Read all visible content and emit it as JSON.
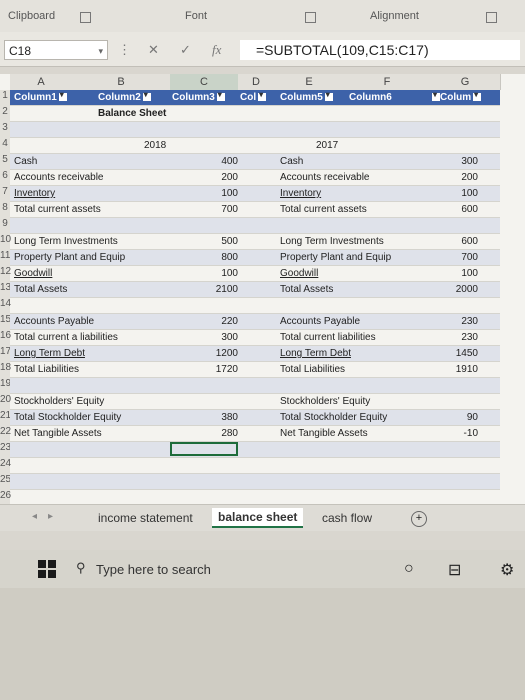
{
  "ribbon": {
    "clipboard": "Clipboard",
    "font": "Font",
    "alignment": "Alignment"
  },
  "formula": {
    "cell_ref": "C18",
    "cancel_icon": "close-icon",
    "enter_icon": "check-icon",
    "fx": "fx",
    "value": "=SUBTOTAL(109,C15:C17)"
  },
  "columns": [
    "A",
    "B",
    "C",
    "D",
    "E",
    "F",
    "G"
  ],
  "header_row": {
    "col1": "Column1",
    "col2": "Column2",
    "col3": "Column3",
    "col4": "Col",
    "col5": "Column5",
    "col6": "Column6",
    "col7": "Colum"
  },
  "rows": {
    "r2_title": "Balance Sheet",
    "r4_2018": "2018",
    "r4_2017": "2017",
    "r5": {
      "label": "Cash",
      "v2018": "400",
      "label2": "Cash",
      "v2017": "300"
    },
    "r6": {
      "label": "Accounts receivable",
      "v2018": "200",
      "label2": "Accounts receivable",
      "v2017": "200"
    },
    "r7": {
      "label": "Inventory",
      "v2018": "100",
      "label2": "Inventory",
      "v2017": "100"
    },
    "r8": {
      "label": "Total current assets",
      "v2018": "700",
      "label2": "Total current assets",
      "v2017": "600"
    },
    "r10": {
      "label": "Long Term Investments",
      "v2018": "500",
      "label2": "Long Term Investments",
      "v2017": "600"
    },
    "r11": {
      "label": "Property Plant and Equip",
      "v2018": "800",
      "label2": "Property Plant and Equip",
      "v2017": "700"
    },
    "r12": {
      "label": "Goodwill",
      "v2018": "100",
      "label2": "Goodwill",
      "v2017": "100"
    },
    "r13": {
      "label": "Total Assets",
      "v2018": "2100",
      "label2": "Total Assets",
      "v2017": "2000"
    },
    "r15": {
      "label": "Accounts Payable",
      "v2018": "220",
      "label2": "Accounts Payable",
      "v2017": "230"
    },
    "r16": {
      "label": "Total current a liabilities",
      "v2018": "300",
      "label2": "Total current liabilities",
      "v2017": "230"
    },
    "r17": {
      "label": "Long Term Debt",
      "v2018": "1200",
      "label2": "Long Term Debt",
      "v2017": "1450"
    },
    "r18": {
      "label": "Total Liabilities",
      "v2018": "1720",
      "label2": "Total Liabilities",
      "v2017": "1910"
    },
    "r20": {
      "label": "Stockholders' Equity",
      "label2": "Stockholders' Equity"
    },
    "r21": {
      "label": "Total Stockholder Equity",
      "v2018": "380",
      "label2": "Total Stockholder Equity",
      "v2017": "90"
    },
    "r22": {
      "label": "Net Tangible Assets",
      "v2018": "280",
      "label2": "Net Tangible Assets",
      "v2017": "-10"
    }
  },
  "row_numbers": [
    "1",
    "2",
    "3",
    "4",
    "5",
    "6",
    "7",
    "8",
    "9",
    "10",
    "11",
    "12",
    "13",
    "14",
    "15",
    "16",
    "17",
    "18",
    "19",
    "20",
    "21",
    "22",
    "23",
    "24",
    "25",
    "26"
  ],
  "tabs": {
    "t1": "income statement",
    "t2": "balance sheet",
    "t3": "cash flow",
    "add": "+"
  },
  "taskbar": {
    "search_placeholder": "Type here to search"
  }
}
